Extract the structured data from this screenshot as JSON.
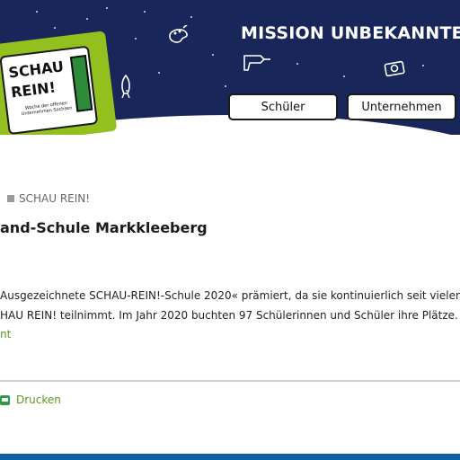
{
  "header": {
    "title": "MISSION UNBEKANNTE",
    "nav_buttons": [
      {
        "label": "Schüler"
      },
      {
        "label": "Unternehmen"
      }
    ]
  },
  "logo": {
    "line1": "SCHAU",
    "line2": "REIN!",
    "tagline": "Woche der offenen Unternehmen Sachsen"
  },
  "breadcrumb": {
    "label": "SCHAU REIN!"
  },
  "page": {
    "title": "and-Schule Markkleeberg",
    "body_lines": [
      "Ausgezeichnete SCHAU-REIN!-Schule 2020« prämiert, da sie kontinuierlich seit vielen Ja",
      "HAU REIN! teilnimmt. Im Jahr 2020 buchten 97 Schülerinnen und Schüler ihre Plätze."
    ],
    "link_text": "nt"
  },
  "actions": {
    "print_label": "Drucken"
  },
  "colors": {
    "banner_bg": "#18265a",
    "accent_green": "#93c01f",
    "link_green": "#5a9a1e",
    "footer_blue": "#0b61a4"
  }
}
